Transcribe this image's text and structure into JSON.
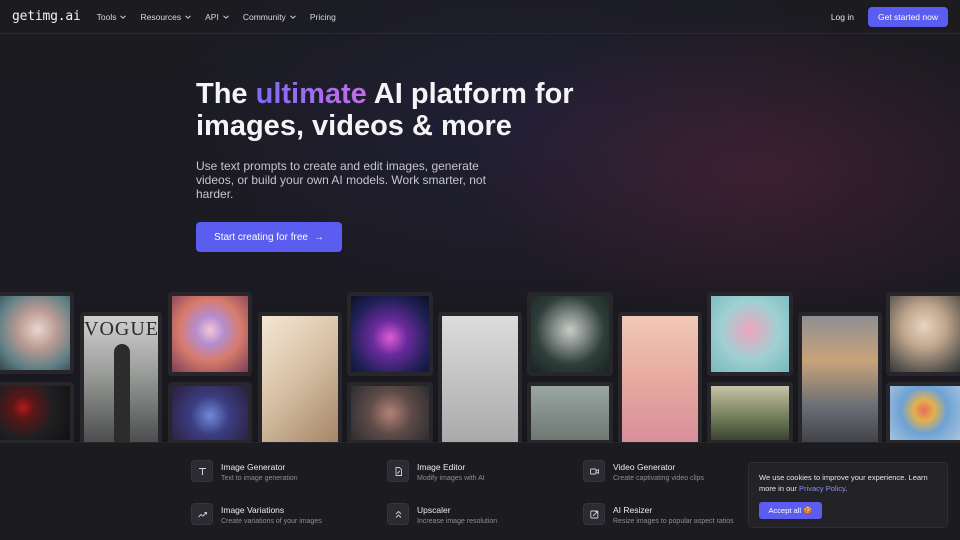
{
  "nav": {
    "logo": "getimg.ai",
    "items": [
      {
        "label": "Tools",
        "dropdown": true
      },
      {
        "label": "Resources",
        "dropdown": true
      },
      {
        "label": "API",
        "dropdown": true
      },
      {
        "label": "Community",
        "dropdown": true
      },
      {
        "label": "Pricing",
        "dropdown": false
      }
    ],
    "login": "Log in",
    "cta": "Get started now"
  },
  "hero": {
    "title_pre": "The ",
    "title_highlight": "ultimate",
    "title_post": " AI platform for images, videos & more",
    "subtitle": "Use text prompts to create and edit images, generate videos, or build your own AI models. Work smarter, not harder.",
    "cta": "Start creating for free",
    "cta_arrow": "→"
  },
  "tools": [
    {
      "title": "Image Generator",
      "desc": "Text to image generation",
      "icon": "text-t-icon"
    },
    {
      "title": "Image Editor",
      "desc": "Modify images with AI",
      "icon": "file-edit-icon"
    },
    {
      "title": "Video Generator",
      "desc": "Create captivating video clips",
      "icon": "video-camera-icon"
    },
    {
      "title": "Image Variations",
      "desc": "Create variations of your images",
      "icon": "shuffle-icon"
    },
    {
      "title": "Upscaler",
      "desc": "Increase image resolution",
      "icon": "chevrons-up-icon"
    },
    {
      "title": "AI Resizer",
      "desc": "Resize images to popular aspect ratios",
      "icon": "resize-icon"
    }
  ],
  "cookie": {
    "text": "We use cookies to improve your experience. Learn more in our ",
    "link": "Privacy Policy",
    "tail": ".",
    "button": "Accept all 🍪"
  },
  "gallery": {
    "vogue_text": "VOGUE"
  },
  "colors": {
    "accent": "#5b5cf0",
    "background": "#16161a",
    "gradient_start": "#7c6cf5",
    "gradient_end": "#c26ee8"
  }
}
